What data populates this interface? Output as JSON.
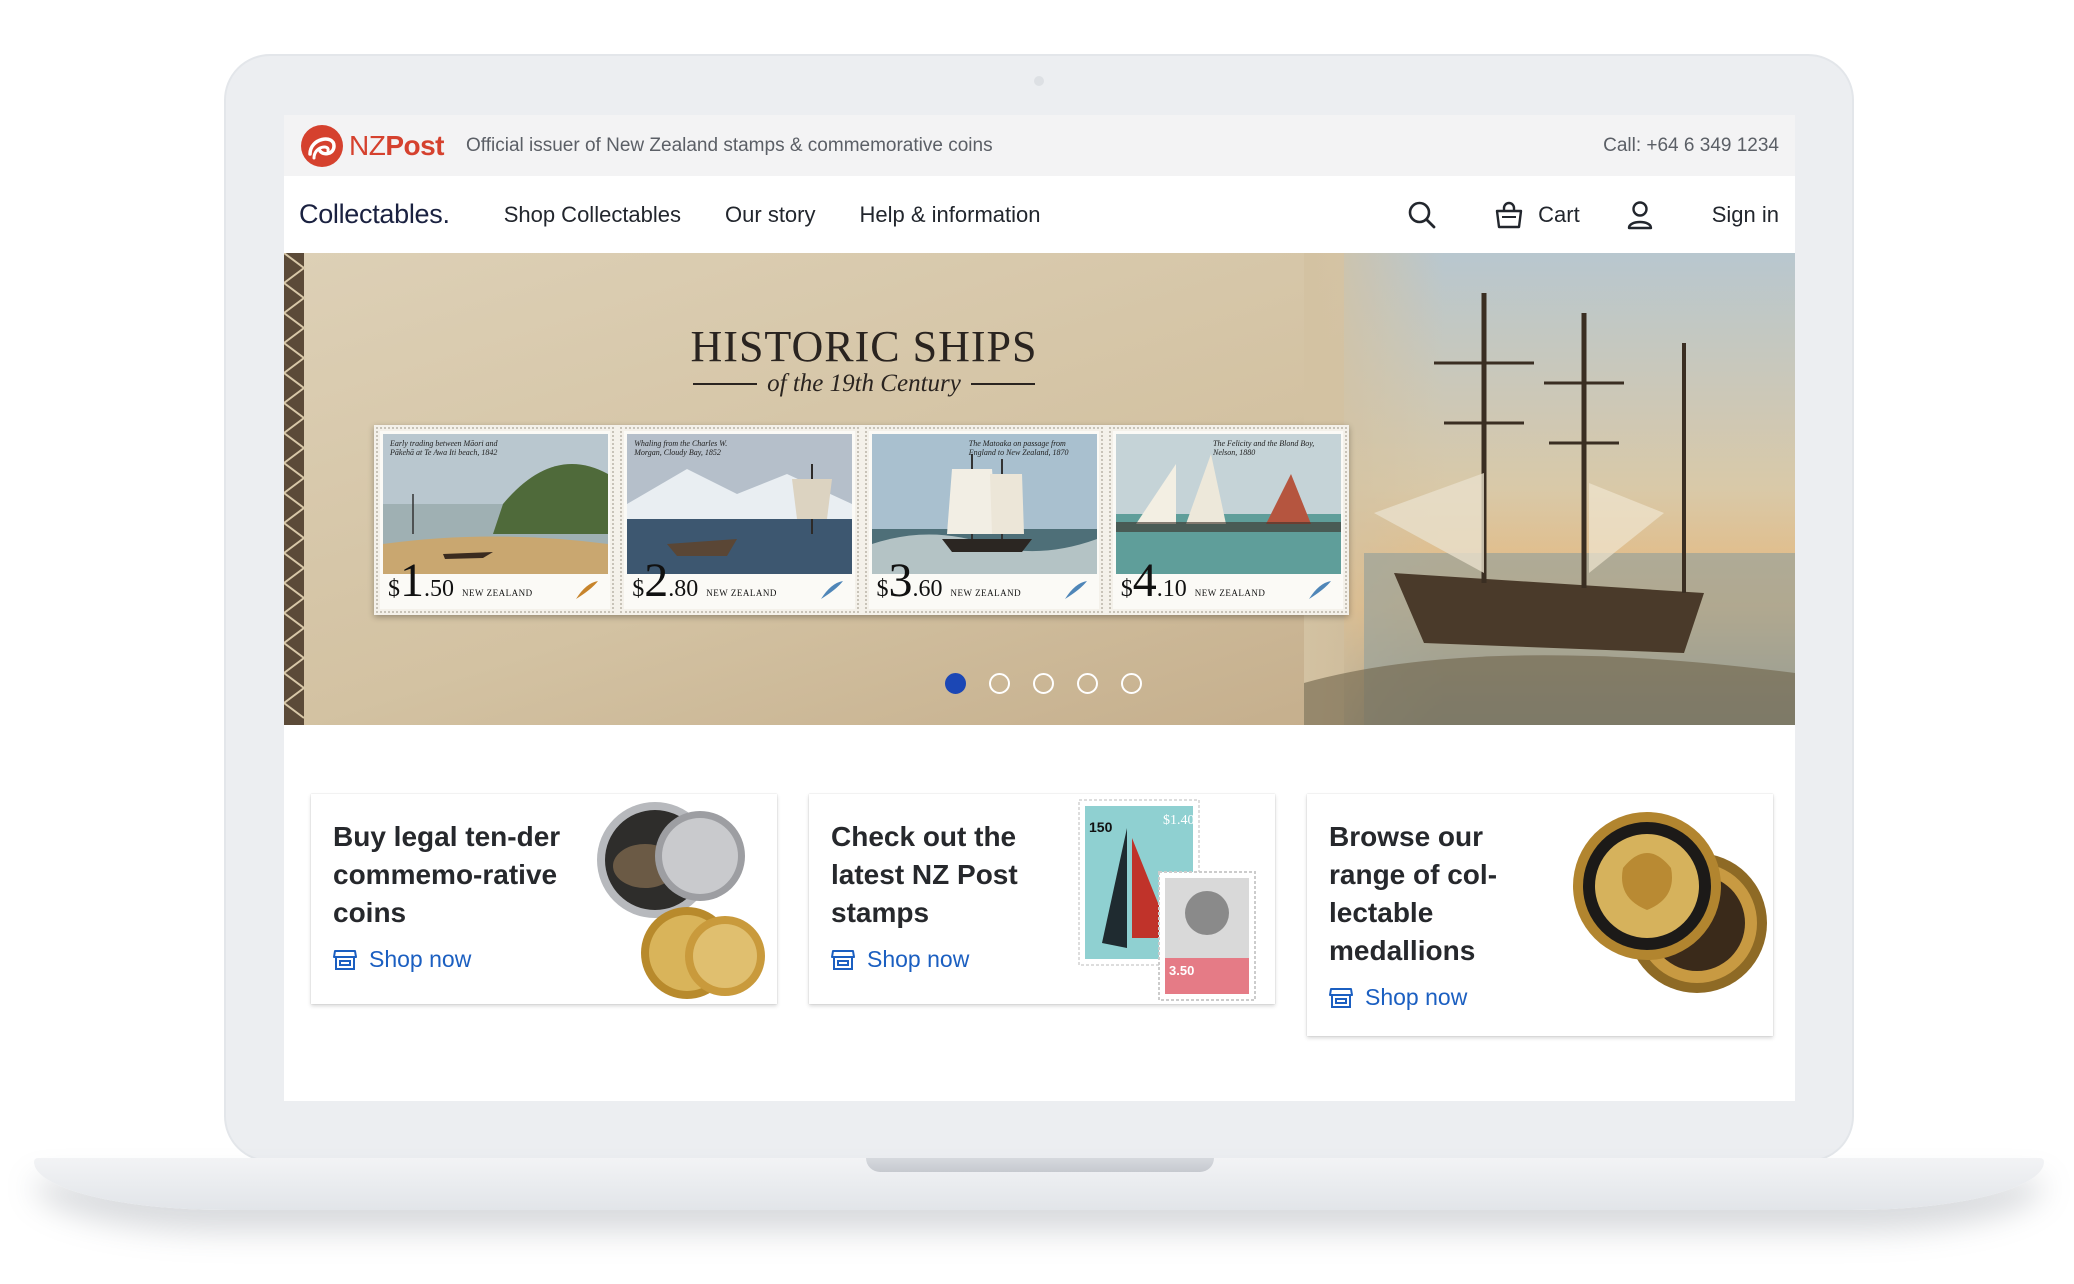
{
  "topbar": {
    "logo_text_light": "NZ",
    "logo_text_bold": "Post",
    "tagline": "Official issuer of New Zealand stamps & commemorative coins",
    "phone": "Call: +64 6 349 1234"
  },
  "nav": {
    "brand": "Collectables.",
    "links": [
      "Shop Collectables",
      "Our story",
      "Help & information"
    ],
    "search_icon": "search-icon",
    "cart_label": "Cart",
    "cart_icon": "shopping-bag-icon",
    "user_icon": "user-icon",
    "signin_label": "Sign in"
  },
  "hero": {
    "title": "HISTORIC SHIPS",
    "subtitle": "of the 19th Century",
    "stamps": [
      {
        "caption": "Early trading between Māori and Pākehā at Te Awa Iti beach, 1842",
        "dollar": "$",
        "big": "1",
        "cents": ".50",
        "country": "NEW ZEALAND"
      },
      {
        "caption": "Whaling from the Charles W. Morgan, Cloudy Bay, 1852",
        "dollar": "$",
        "big": "2",
        "cents": ".80",
        "country": "NEW ZEALAND"
      },
      {
        "caption": "The Matoaka on passage from England to New Zealand, 1870",
        "dollar": "$",
        "big": "3",
        "cents": ".60",
        "country": "NEW ZEALAND"
      },
      {
        "caption": "The Felicity and the Blond Boy, Nelson, 1880",
        "dollar": "$",
        "big": "4",
        "cents": ".10",
        "country": "NEW ZEALAND"
      }
    ],
    "slides_total": 5,
    "active_slide": 1,
    "accent_color": "#1b47b5"
  },
  "cards": [
    {
      "title": "Buy legal ten-der commemo-rative coins",
      "link": "Shop now",
      "icon": "store-icon"
    },
    {
      "title": "Check out the latest NZ Post stamps",
      "link": "Shop now",
      "icon": "store-icon"
    },
    {
      "title": "Browse our range of col-lectable medallions",
      "link": "Shop now",
      "icon": "store-icon"
    }
  ],
  "colors": {
    "brand_red": "#d5412e",
    "link_blue": "#1b5fc1",
    "text_dark": "#22262d"
  }
}
